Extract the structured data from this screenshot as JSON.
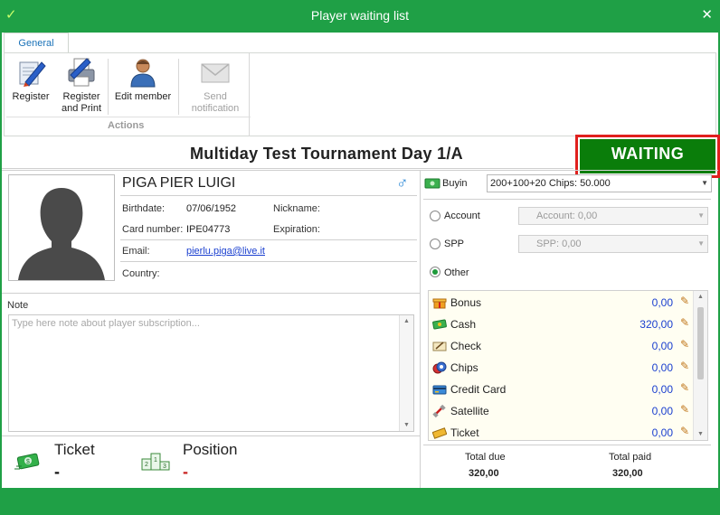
{
  "window": {
    "title": "Player waiting list",
    "close_glyph": "✕",
    "check_glyph": "✓"
  },
  "ribbon": {
    "tab": "General",
    "buttons": [
      {
        "label": "Register"
      },
      {
        "label": "Register\nand Print"
      },
      {
        "label": "Edit member"
      },
      {
        "label": "Send\nnotification",
        "disabled": true
      }
    ],
    "group_label": "Actions"
  },
  "tournament": {
    "title": "Multiday Test Tournament  Day 1/A",
    "status": "WAITING"
  },
  "player": {
    "name": "PIGA PIER LUIGI",
    "gender_glyph": "♂",
    "fields": {
      "birthdate_label": "Birthdate:",
      "birthdate": "07/06/1952",
      "nickname_label": "Nickname:",
      "nickname": "",
      "card_label": "Card number:",
      "card": "IPE04773",
      "expiration_label": "Expiration:",
      "expiration": "",
      "email_label": "Email:",
      "email": "pierlu.piga@live.it",
      "country_label": "Country:",
      "country": ""
    }
  },
  "note": {
    "label": "Note",
    "placeholder": "Type here note about player subscription..."
  },
  "stats": {
    "ticket_label": "Ticket",
    "ticket_value": "-",
    "position_label": "Position",
    "position_value": "-"
  },
  "payment": {
    "buyin_label": "Buyin",
    "buyin_value": "200+100+20 Chips: 50.000",
    "account_label": "Account",
    "account_value": "Account: 0,00",
    "spp_label": "SPP",
    "spp_value": "SPP: 0,00",
    "other_label": "Other",
    "methods": [
      {
        "name": "Bonus",
        "value": "0,00",
        "icon": "gift-icon"
      },
      {
        "name": "Cash",
        "value": "320,00",
        "icon": "cash-icon"
      },
      {
        "name": "Check",
        "value": "0,00",
        "icon": "check-icon"
      },
      {
        "name": "Chips",
        "value": "0,00",
        "icon": "chips-icon"
      },
      {
        "name": "Credit Card",
        "value": "0,00",
        "icon": "credit-card-icon"
      },
      {
        "name": "Satellite",
        "value": "0,00",
        "icon": "satellite-icon"
      },
      {
        "name": "Ticket",
        "value": "0,00",
        "icon": "ticket-icon"
      }
    ],
    "edit_glyph": "✎",
    "total_due_label": "Total due",
    "total_due": "320,00",
    "total_paid_label": "Total paid",
    "total_paid": "320,00"
  },
  "colors": {
    "window_green": "#1fa046",
    "status_green": "#0a7d0a",
    "highlight_red": "#e0201e",
    "link_blue": "#1a3fcf"
  }
}
